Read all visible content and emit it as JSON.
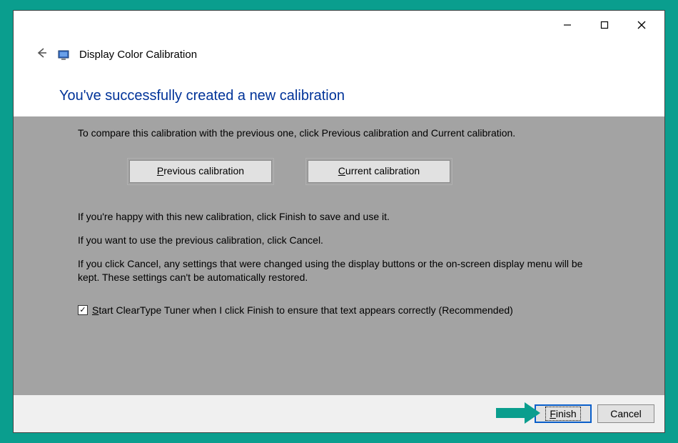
{
  "window": {
    "title": "Display Color Calibration",
    "heading": "You've successfully created a new calibration"
  },
  "content": {
    "intro": "To compare this calibration with the previous one, click Previous calibration and Current calibration.",
    "buttons": {
      "previous": "Previous calibration",
      "current": "Current calibration"
    },
    "happy": "If you're happy with this new calibration, click Finish to save and use it.",
    "use_previous": "If you want to use the previous calibration, click Cancel.",
    "cancel_note": "If you click Cancel, any settings that were changed using the display buttons or the on-screen display menu will be kept. These settings can't be automatically restored.",
    "checkbox_label": "Start ClearType Tuner when I click Finish to ensure that text appears correctly (Recommended)",
    "checkbox_checked": true
  },
  "footer": {
    "finish": "Finish",
    "cancel": "Cancel"
  }
}
